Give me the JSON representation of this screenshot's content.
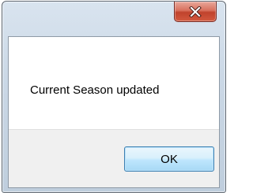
{
  "dialog": {
    "message": "Current Season updated",
    "ok_label": "OK",
    "close_icon": "close-icon"
  },
  "colors": {
    "close_button": "#c0422c",
    "ok_button_border": "#3c7fb1",
    "footer_background": "#f0f0f0"
  }
}
